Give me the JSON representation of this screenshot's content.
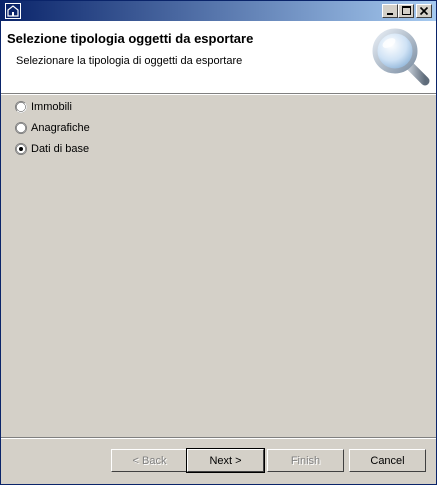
{
  "window": {
    "title": ""
  },
  "header": {
    "title": "Selezione tipologia oggetti da esportare",
    "description": "Selezionare la tipologia di oggetti da esportare",
    "graphic": "magnifier-icon"
  },
  "options": {
    "items": [
      {
        "label": "Immobili",
        "selected": false
      },
      {
        "label": "Anagrafiche",
        "selected": false
      },
      {
        "label": "Dati di base",
        "selected": true
      }
    ]
  },
  "buttons": {
    "back": {
      "label": "< Back",
      "enabled": false
    },
    "next": {
      "label": "Next >",
      "enabled": true
    },
    "finish": {
      "label": "Finish",
      "enabled": false
    },
    "cancel": {
      "label": "Cancel",
      "enabled": true
    }
  },
  "colors": {
    "titlebar_start": "#0a246a",
    "titlebar_end": "#a6caf0",
    "panel": "#d4d0c8",
    "header_bg": "#ffffff"
  }
}
